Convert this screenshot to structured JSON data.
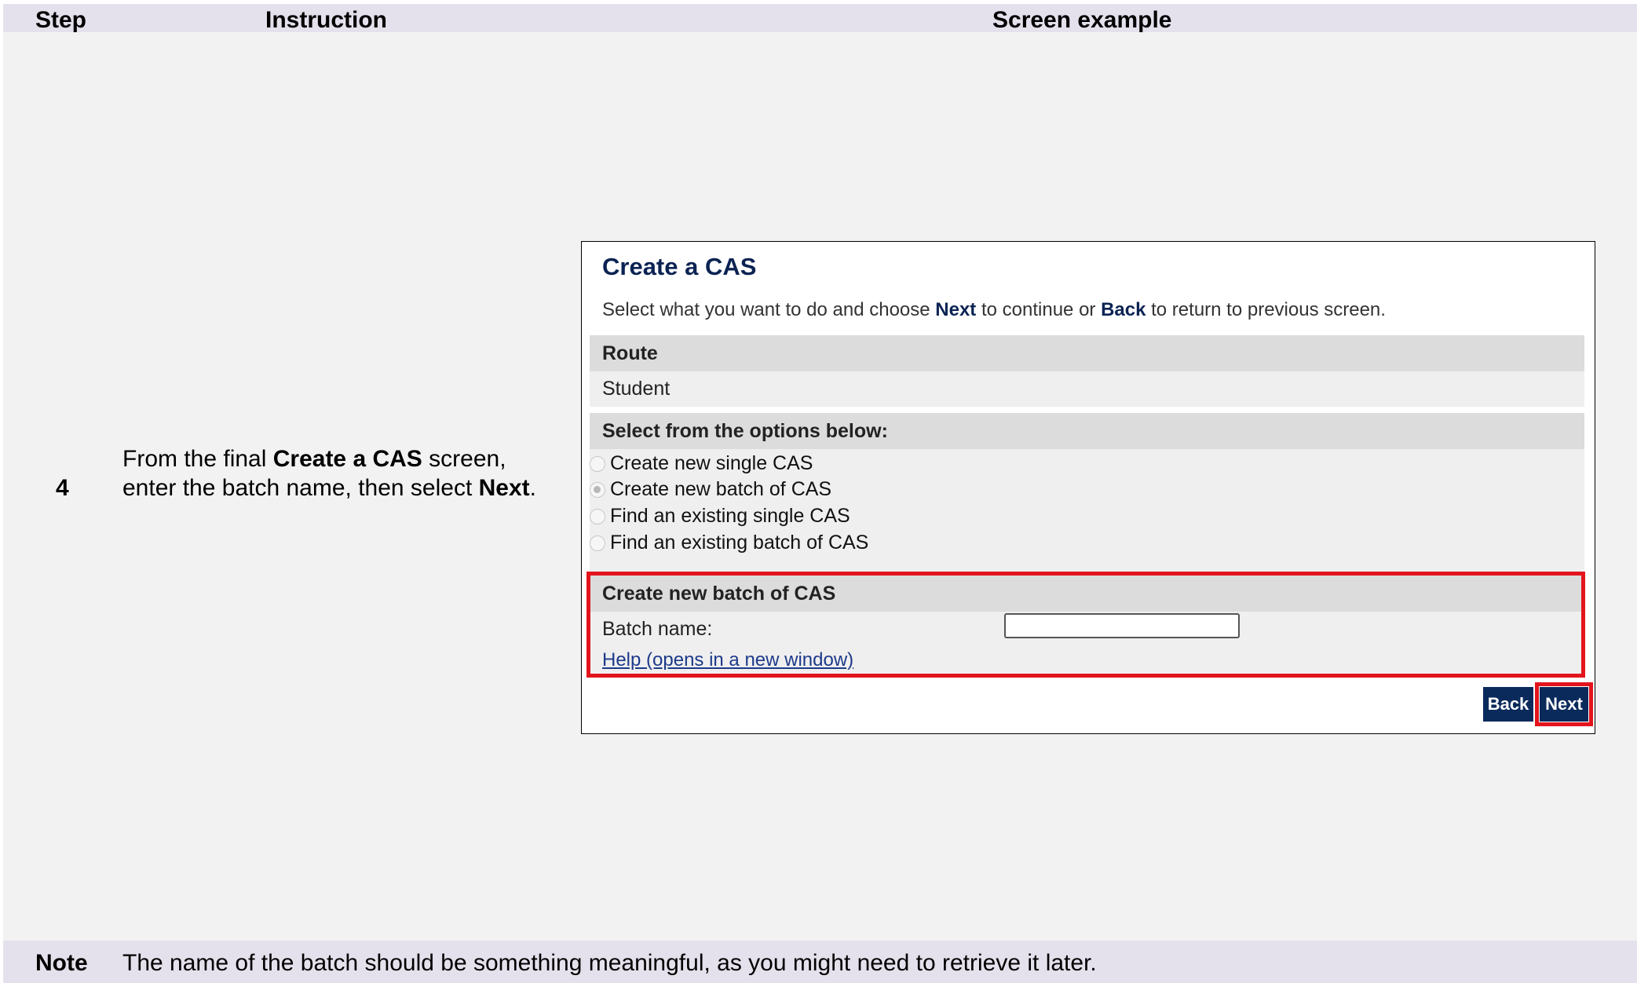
{
  "table": {
    "headers": {
      "step": "Step",
      "instruction": "Instruction",
      "screen": "Screen example"
    },
    "row": {
      "step": "4",
      "instruction": {
        "part1": "From the final ",
        "bold1": "Create a CAS",
        "part2": " screen, enter the batch name, then select ",
        "bold2": "Next",
        "part3": "."
      }
    },
    "note": {
      "label": "Note",
      "text": "The name of the batch should be something meaningful, as you might need to retrieve it later."
    }
  },
  "screen": {
    "title": "Create a CAS",
    "intro": {
      "part1": "Select what you want to do and choose ",
      "next": "Next",
      "part2": " to continue or ",
      "back": "Back",
      "part3": " to return to previous screen."
    },
    "route_header": "Route",
    "route_value": "Student",
    "options_header": "Select from the options below:",
    "options": [
      {
        "label": "Create new single CAS",
        "selected": false
      },
      {
        "label": "Create new batch of CAS",
        "selected": true
      },
      {
        "label": "Find an existing single CAS",
        "selected": false
      },
      {
        "label": "Find an existing batch of CAS",
        "selected": false
      }
    ],
    "batch_header": "Create new batch of CAS",
    "batch_label": "Batch name:",
    "batch_value": "",
    "help_link": "Help (opens in a new window)",
    "back_button": "Back",
    "next_button": "Next",
    "highlight_color": "#e3141c",
    "title_color": "#0b2353"
  }
}
